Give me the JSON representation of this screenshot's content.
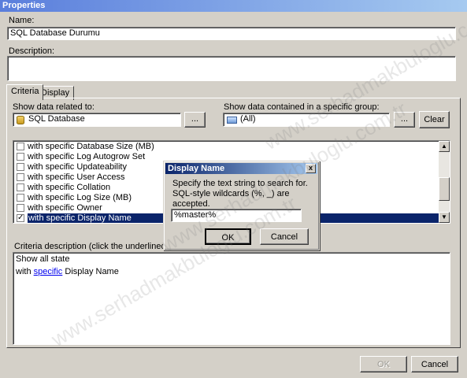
{
  "window": {
    "title": "Properties"
  },
  "name_label": "Name:",
  "name_value": "SQL Database Durumu",
  "description_label": "Description:",
  "description_value": "",
  "tabs": [
    {
      "label": "Criteria"
    },
    {
      "label": "Display"
    }
  ],
  "criteria": {
    "related_label": "Show data related to:",
    "related_value": "SQL Database",
    "related_browse": "...",
    "group_label": "Show data contained in a specific group:",
    "group_value": "(All)",
    "group_browse": "...",
    "clear_label": "Clear",
    "conditions": [
      {
        "label": "with specific Database Size (MB)",
        "checked": false
      },
      {
        "label": "with specific Log Autogrow Set",
        "checked": false
      },
      {
        "label": "with specific Updateability",
        "checked": false
      },
      {
        "label": "with specific User Access",
        "checked": false
      },
      {
        "label": "with specific Collation",
        "checked": false
      },
      {
        "label": "with specific Log Size (MB)",
        "checked": false
      },
      {
        "label": "with specific Owner",
        "checked": false
      },
      {
        "label": "with specific Display Name",
        "checked": true
      }
    ],
    "desc_label": "Criteria description (click the underlined value to",
    "desc_line1": "Show all state",
    "desc_line2_pre": "with",
    "desc_line2_link": "specific",
    "desc_line2_post": "Display Name"
  },
  "dialog": {
    "title": "Display Name",
    "close": "x",
    "message": "Specify the text string to search for. SQL-style wildcards (%, _) are accepted.",
    "input_value": "%master%",
    "ok": "OK",
    "cancel": "Cancel"
  },
  "footer": {
    "ok": "OK",
    "cancel": "Cancel"
  },
  "watermark": "www.serhadmakbuloglu.com.tr",
  "colors": {
    "selection": "#0a246a",
    "dialog_title": "#0a246a",
    "link": "#0000ee"
  }
}
